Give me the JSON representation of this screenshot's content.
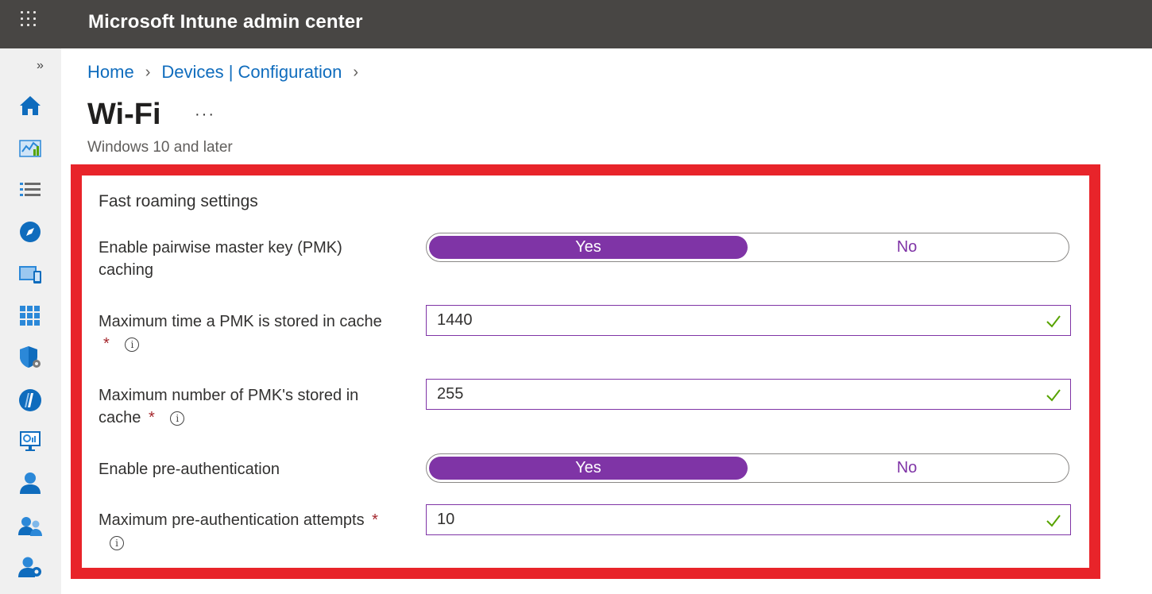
{
  "app": {
    "title": "Microsoft Intune admin center"
  },
  "breadcrumb": [
    {
      "label": "Home"
    },
    {
      "label": "Devices | Configuration"
    }
  ],
  "page": {
    "title": "Wi-Fi",
    "more": "···",
    "subtitle": "Windows 10 and later"
  },
  "nav": {
    "collapse": "»",
    "icons": [
      "home-icon",
      "dashboard-icon",
      "all-services-icon",
      "explorer-icon",
      "devices-icon",
      "apps-icon",
      "endpoint-security-icon",
      "reports-icon",
      "tenant-admin-monitor-icon",
      "users-icon",
      "groups-icon",
      "tenant-administration-icon"
    ]
  },
  "section": {
    "title": "Fast roaming settings",
    "pmk_caching": {
      "label": "Enable pairwise master key (PMK) caching",
      "yes": "Yes",
      "no": "No",
      "selected": "Yes"
    },
    "pmk_max_time": {
      "label": "Maximum time a PMK is stored in cache",
      "required": "*",
      "value": "1440"
    },
    "pmk_max_count": {
      "label": "Maximum number of PMK's stored in cache",
      "required": "*",
      "value": "255"
    },
    "preauth": {
      "label": "Enable pre-authentication",
      "yes": "Yes",
      "no": "No",
      "selected": "Yes"
    },
    "preauth_attempts": {
      "label": "Maximum pre-authentication attempts",
      "required": "*",
      "value": "10"
    }
  },
  "colors": {
    "topbar": "#484644",
    "accent": "#7f34a6",
    "link": "#0f6cbd",
    "highlight": "#e8242a",
    "valid": "#57a300"
  }
}
